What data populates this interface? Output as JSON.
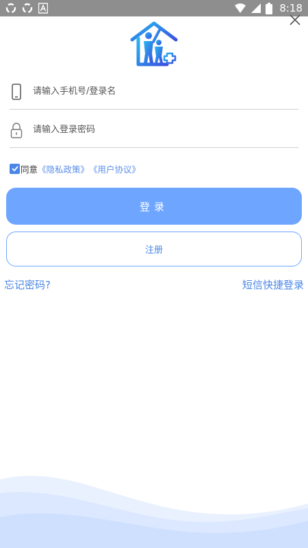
{
  "status_bar": {
    "time": "8:18",
    "icons": [
      "sync-icon",
      "sync-icon",
      "app-a-icon",
      "wifi-icon",
      "signal-icon",
      "battery-icon"
    ]
  },
  "form": {
    "phone_placeholder": "请输入手机号/登录名",
    "password_placeholder": "请输入登录密码"
  },
  "agreement": {
    "checked": true,
    "prefix": "同意",
    "privacy_link": "《隐私政策》",
    "user_link": "《用户协议》"
  },
  "buttons": {
    "login": "登录",
    "register": "注册"
  },
  "links": {
    "forgot_password": "忘记密码?",
    "sms_login": "短信快捷登录"
  },
  "colors": {
    "primary": "#6ea5ff",
    "link": "#4a86e8",
    "status_bar": "#8e8e8e"
  }
}
